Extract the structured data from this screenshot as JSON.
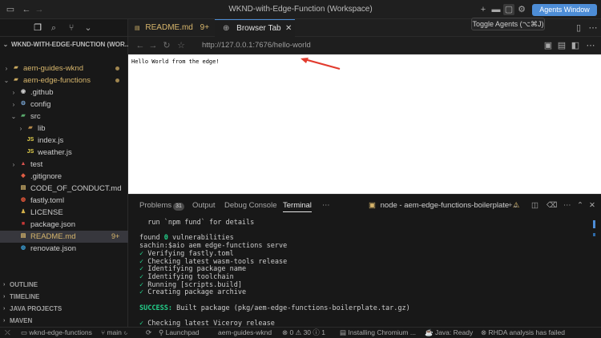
{
  "window": {
    "title": "WKND-with-Edge-Function (Workspace)",
    "agents_button": "Agents Window",
    "tooltip": "Toggle Agents (⌥⌘J)"
  },
  "sidebar": {
    "workspace_header": "WKND-WITH-EDGE-FUNCTION (WOR...",
    "tree": [
      {
        "label": "aem-guides-wknd",
        "depth": 1,
        "chevron": "›",
        "icon": "folder-icon",
        "dot": true
      },
      {
        "label": "aem-edge-functions",
        "depth": 1,
        "chevron": "⌄",
        "icon": "folder-icon",
        "dot": true
      },
      {
        "label": ".github",
        "depth": 2,
        "chevron": "›",
        "icon": "github-folder-icon"
      },
      {
        "label": "config",
        "depth": 2,
        "chevron": "›",
        "icon": "config-folder-icon"
      },
      {
        "label": "src",
        "depth": 2,
        "chevron": "⌄",
        "icon": "src-folder-icon"
      },
      {
        "label": "lib",
        "depth": 3,
        "chevron": "›",
        "icon": "lib-folder-icon"
      },
      {
        "label": "index.js",
        "depth": 3,
        "icon": "js-file-icon"
      },
      {
        "label": "weather.js",
        "depth": 3,
        "icon": "js-file-icon"
      },
      {
        "label": "test",
        "depth": 2,
        "chevron": "›",
        "icon": "test-folder-icon"
      },
      {
        "label": ".gitignore",
        "depth": 2,
        "icon": "git-file-icon"
      },
      {
        "label": "CODE_OF_CONDUCT.md",
        "depth": 2,
        "icon": "markdown-file-icon"
      },
      {
        "label": "fastly.toml",
        "depth": 2,
        "icon": "toml-file-icon"
      },
      {
        "label": "LICENSE",
        "depth": 2,
        "icon": "license-file-icon"
      },
      {
        "label": "package.json",
        "depth": 2,
        "icon": "npm-file-icon"
      },
      {
        "label": "README.md",
        "depth": 2,
        "icon": "markdown-file-icon",
        "badge": "9+",
        "selected": true
      },
      {
        "label": "renovate.json",
        "depth": 2,
        "icon": "renovate-file-icon"
      }
    ],
    "sections": [
      "OUTLINE",
      "TIMELINE",
      "JAVA PROJECTS",
      "MAVEN"
    ]
  },
  "tabs": [
    {
      "label": "README.md",
      "badge": "9+",
      "active": false
    },
    {
      "label": "Browser Tab",
      "active": true
    }
  ],
  "browser": {
    "url": "http://127.0.0.1:7676/hello-world",
    "page_text": "Hello World from the edge!"
  },
  "panel": {
    "tabs": [
      {
        "label": "Problems",
        "badge": "31"
      },
      {
        "label": "Output"
      },
      {
        "label": "Debug Console"
      },
      {
        "label": "Terminal",
        "active": true
      }
    ],
    "terminal_name": "node - aem-edge-functions-boilerplate",
    "lines": [
      "  run `npm fund` for details",
      "",
      "found 0 vulnerabilities",
      "sachin:$aio aem edge-functions serve",
      "✓ Verifying fastly.toml",
      "✓ Checking latest wasm-tools release",
      "✓ Identifying package name",
      "✓ Identifying toolchain",
      "✓ Running [scripts.build]",
      "✓ Creating package archive",
      "",
      "SUCCESS: Built package (pkg/aem-edge-functions-boilerplate.tar.gz)",
      "",
      "✓ Checking latest Viceroy release"
    ]
  },
  "statusbar": {
    "remote": "wknd-edge-functions",
    "branch": "main",
    "launchpad": "Launchpad",
    "project": "aem-guides-wknd",
    "errors": "0",
    "warnings": "30",
    "infos": "1",
    "installing": "Installing Chromium ...",
    "java": "Java: Ready",
    "rhda": "RHDA analysis has failed"
  },
  "colors": {
    "accent": "#4d8dd6",
    "background": "#1e1e1e",
    "selection": "#37373d"
  }
}
